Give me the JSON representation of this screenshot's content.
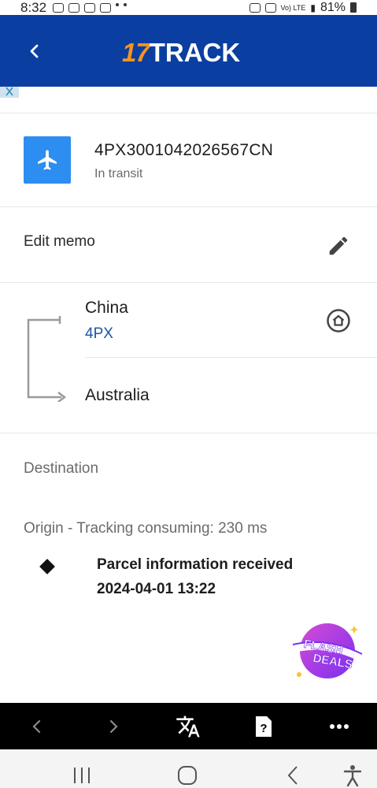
{
  "status_bar": {
    "time": "8:32",
    "battery": "81%",
    "network": "Vo) LTE"
  },
  "header": {
    "brand_number": "17",
    "brand_word": "TRACK",
    "colors": {
      "background": "#0a3fa1",
      "brand_number": "#f7931e"
    }
  },
  "parcel": {
    "tracking_number": "4PX3001042026567CN",
    "status": "In transit",
    "icon": "airplane-icon",
    "icon_color": "#2b8ef0"
  },
  "memo": {
    "label": "Edit memo",
    "icon": "pencil-icon"
  },
  "route": {
    "origin": "China",
    "carrier": "4PX",
    "destination": "Australia",
    "icon": "home-icon"
  },
  "sections": {
    "destination_label": "Destination",
    "origin_label": "Origin - Tracking consuming: 230 ms"
  },
  "events": [
    {
      "title": "Parcel information received",
      "time": "2024-04-01 13:22"
    }
  ],
  "promo": {
    "line1": "FLASH",
    "line2": "DEALS"
  },
  "browser_toolbar": {
    "items": [
      "back-icon",
      "forward-icon",
      "translate-icon",
      "help-card-icon",
      "more-icon"
    ]
  },
  "system_nav": {
    "items": [
      "recent-apps-icon",
      "home-button-icon",
      "back-nav-icon",
      "accessibility-icon"
    ]
  }
}
